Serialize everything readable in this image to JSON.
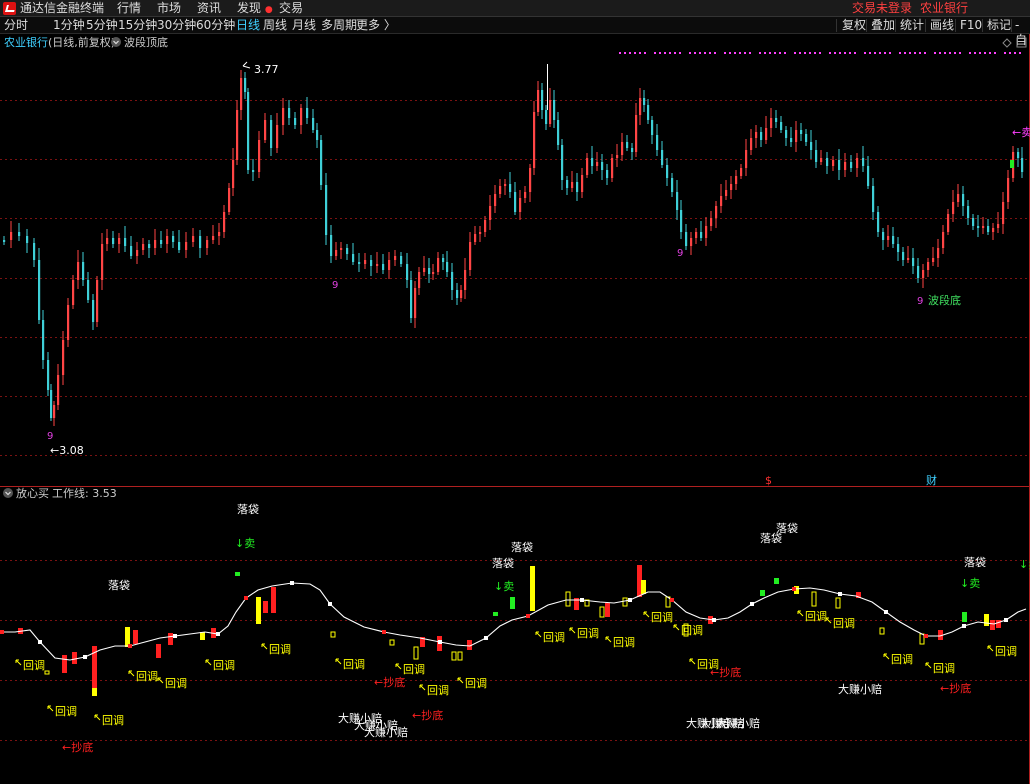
{
  "app": {
    "title": "通达信金融终端",
    "menu": [
      "行情",
      "市场",
      "资讯",
      "发现",
      "交易"
    ],
    "login_status": "交易未登录",
    "current_stock": "农业银行"
  },
  "toolbar": {
    "periods": [
      "分时",
      "1分钟",
      "5分钟",
      "15分钟",
      "30分钟",
      "60分钟",
      "日线",
      "周线",
      "月线",
      "多周期",
      "更多 〉"
    ],
    "active_period": "日线",
    "right_buttons": [
      "复权",
      "叠加",
      "统计",
      "画线",
      "F10",
      "标记",
      "-自"
    ]
  },
  "main_chart": {
    "stock_label": "农业银行",
    "info_label": "(日线,前复权)",
    "indicator_label": "波段顶底",
    "high_label": "3.77",
    "low_label": "←3.08",
    "nine_marks": [
      "9",
      "9",
      "9",
      "9"
    ],
    "bottom_label": "波段底",
    "sell_label": "←卖",
    "markers": [
      "$",
      "财"
    ],
    "colors": {
      "up": "#ff4545",
      "down": "#3fd0d8",
      "grid": "#7a1212",
      "magenta": "#ff40ff"
    }
  },
  "sub_chart": {
    "indicator_label": "放心买",
    "work_line_label": "工作线: 3.53",
    "labels": {
      "pullback": "回调",
      "bottom_fish": "←抄底",
      "bag": "落袋",
      "sell": "↓卖",
      "small": "大赚小赔"
    },
    "colors": {
      "yellow": "#ffff00",
      "red": "#ff2020",
      "green": "#22ee22",
      "white": "#ffffff",
      "orange": "#ffd700"
    }
  }
}
